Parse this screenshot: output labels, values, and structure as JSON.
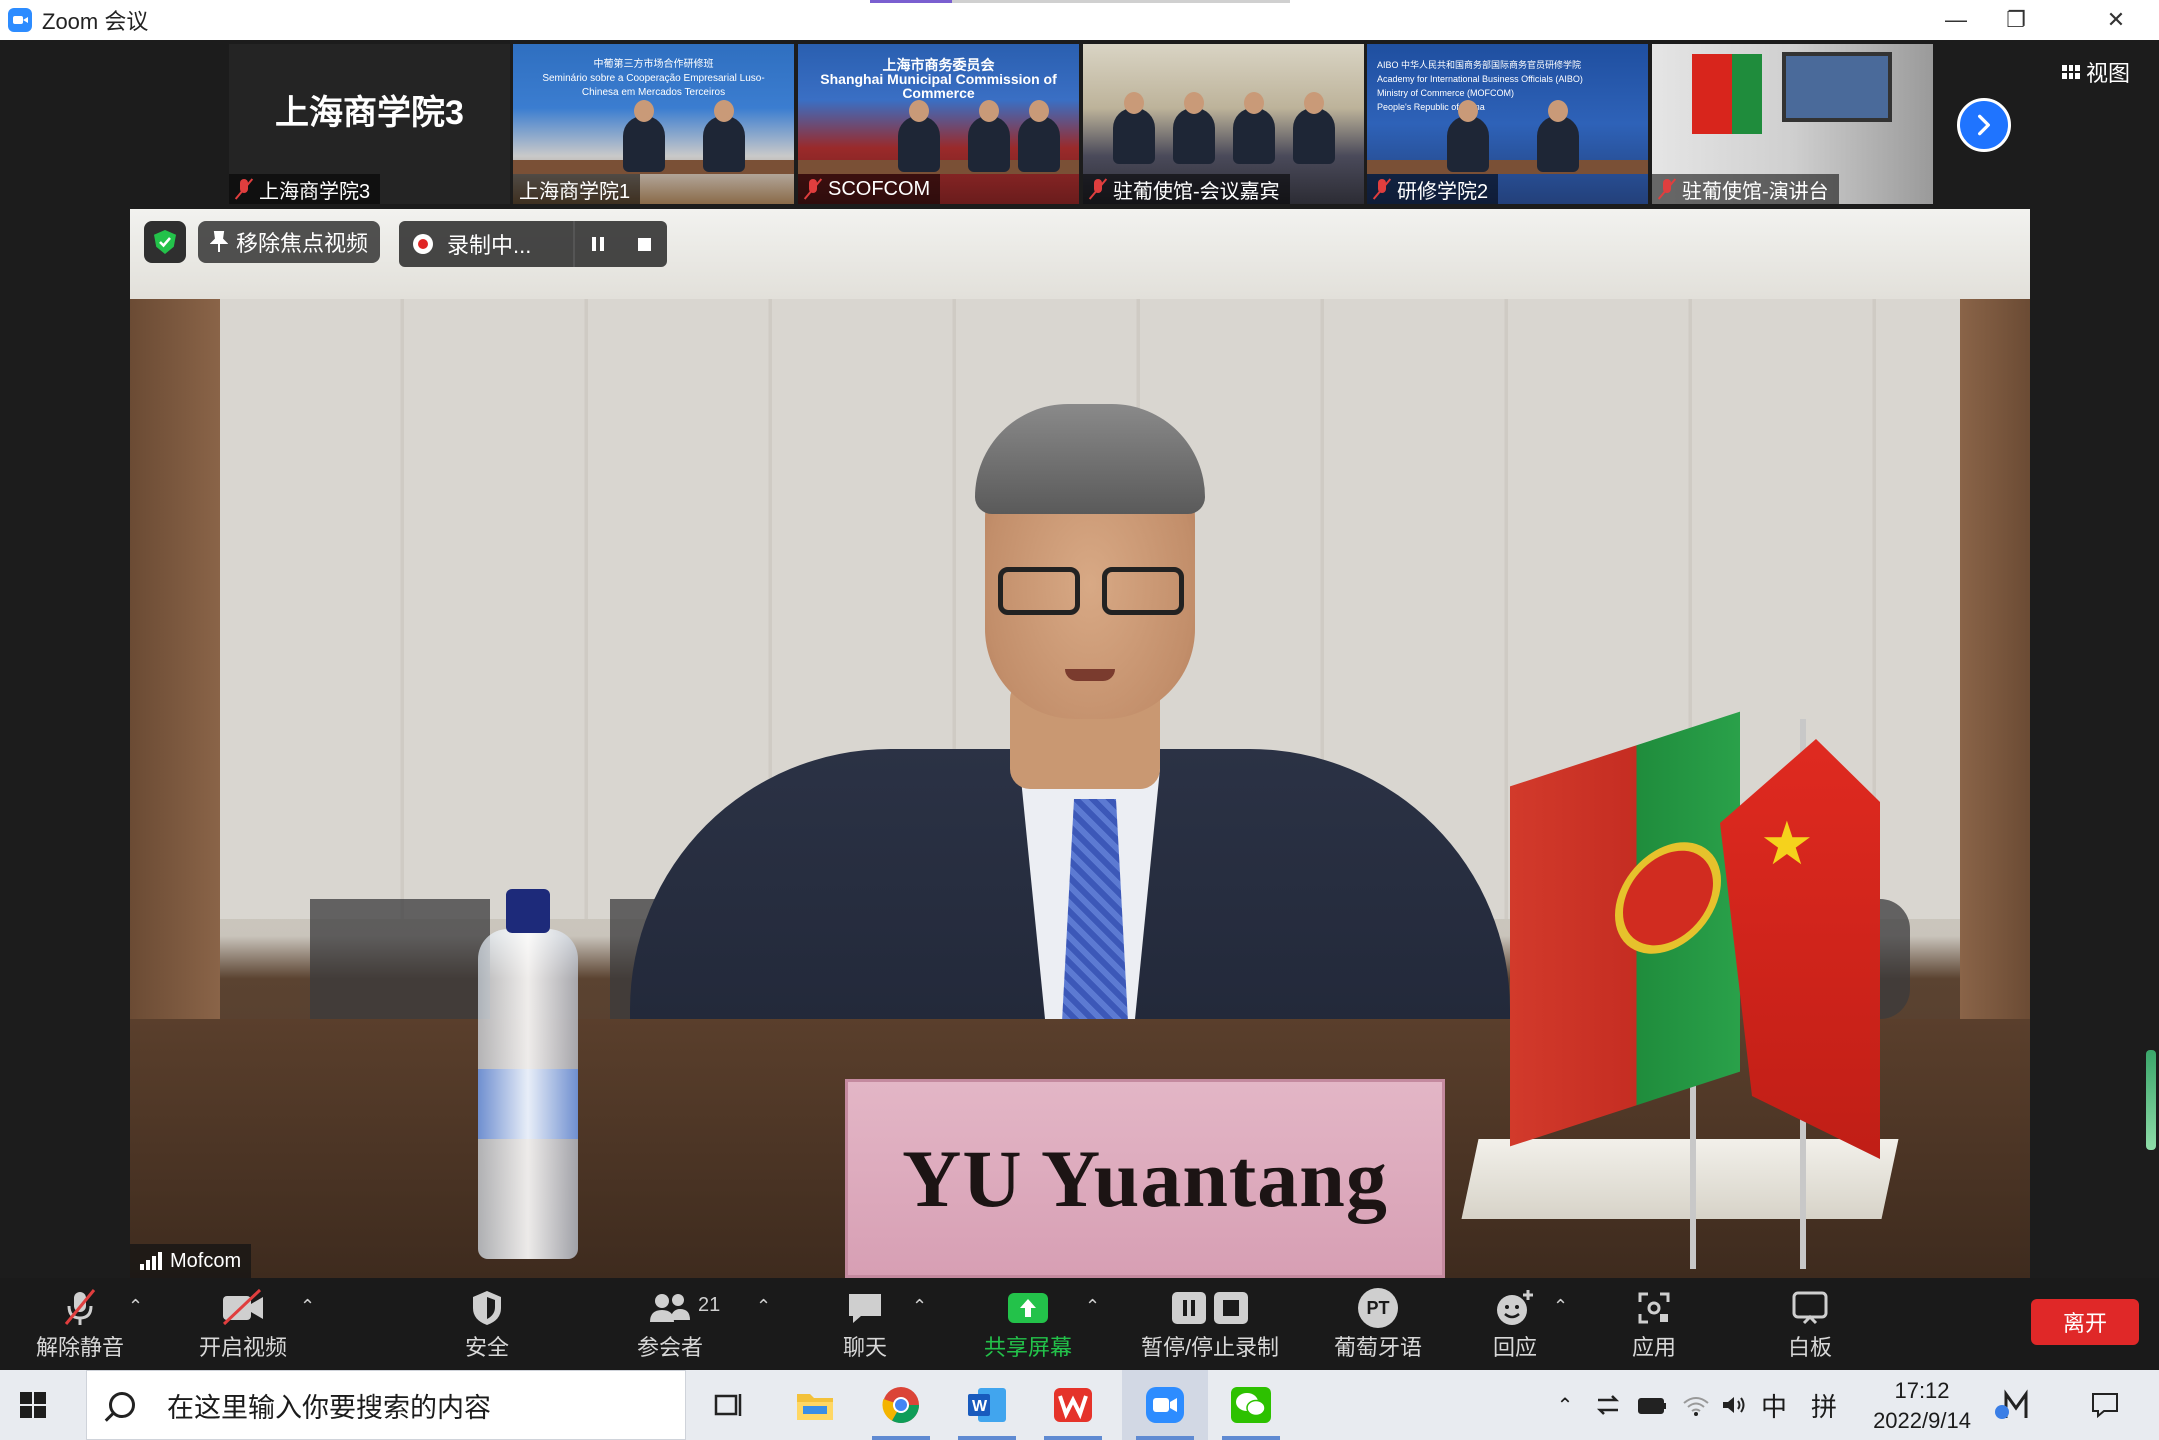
{
  "window": {
    "title": "Zoom 会议",
    "minimize": "—",
    "restore": "❐",
    "close": "✕"
  },
  "thumbnails": [
    {
      "name": "上海商学院3",
      "big_label": "上海商学院3",
      "muted": true
    },
    {
      "name": "上海商学院1",
      "muted": false,
      "banner": "中葡第三方市场合作研修班\nSeminário sobre a Cooperação Empresarial Luso-Chinesa em Mercados Terceiros"
    },
    {
      "name": "SCOFCOM",
      "muted": true,
      "banner": "上海市商务委员会\nShanghai Municipal Commission of Commerce"
    },
    {
      "name": "驻葡使馆-会议嘉宾",
      "muted": true
    },
    {
      "name": "研修学院2",
      "muted": true,
      "banner": "AIBO 中华人民共和国商务部国际商务官员研修学院\nAcademy for International Business Officials (AIBO)\nMinistry of Commerce (MOFCOM)\nPeople's Republic of China"
    },
    {
      "name": "驻葡使馆-演讲台",
      "muted": true
    }
  ],
  "view_button": "视图",
  "main_video": {
    "nameplate": "YU Yuantang",
    "speaker_tag": "Mofcom",
    "remove_spotlight": "移除焦点视频",
    "recording_label": "录制中..."
  },
  "toolbar": {
    "unmute": "解除静音",
    "start_video": "开启视频",
    "security": "安全",
    "participants": "参会者",
    "participants_count": "21",
    "chat": "聊天",
    "share_screen": "共享屏幕",
    "pause_stop_recording": "暂停/停止录制",
    "interpretation": "葡萄牙语",
    "interpretation_badge": "PT",
    "reactions": "回应",
    "apps": "应用",
    "whiteboard": "白板",
    "leave": "离开"
  },
  "taskbar": {
    "search_placeholder": "在这里输入你要搜索的内容",
    "ime_lang": "中",
    "ime_mode": "拼",
    "time": "17:12",
    "date": "2022/9/14"
  },
  "colors": {
    "zoom_blue": "#2d8cff",
    "leave_red": "#e02828",
    "share_green": "#23c24a",
    "muted_red": "#e03e3e"
  }
}
